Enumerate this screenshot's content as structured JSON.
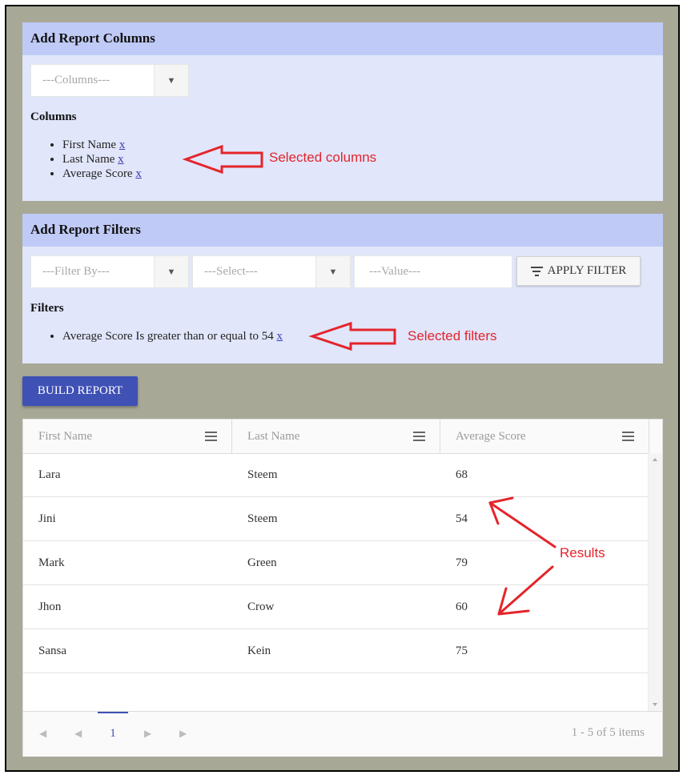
{
  "columns_panel": {
    "title": "Add Report Columns",
    "columns_select_placeholder": "---Columns---",
    "list_title": "Columns",
    "items": [
      {
        "label": "First Name",
        "remove": "x"
      },
      {
        "label": "Last Name",
        "remove": "x"
      },
      {
        "label": "Average Score",
        "remove": "x"
      }
    ]
  },
  "filters_panel": {
    "title": "Add Report Filters",
    "filter_by_placeholder": "---Filter By---",
    "operator_placeholder": "---Select---",
    "value_placeholder": "---Value---",
    "apply_label": "APPLY FILTER",
    "list_title": "Filters",
    "items": [
      {
        "label": "Average Score Is greater than or equal to 54",
        "remove": "x"
      }
    ]
  },
  "build_label": "BUILD REPORT",
  "grid": {
    "headers": [
      "First Name",
      "Last Name",
      "Average Score"
    ],
    "rows": [
      [
        "Lara",
        "Steem",
        "68"
      ],
      [
        "Jini",
        "Steem",
        "54"
      ],
      [
        "Mark",
        "Green",
        "79"
      ],
      [
        "Jhon",
        "Crow",
        "60"
      ],
      [
        "Sansa",
        "Kein",
        "75"
      ]
    ],
    "pager": {
      "current_page": "1",
      "info": "1 - 5 of 5 items",
      "first_icon": "first-page-icon",
      "prev_icon": "prev-page-icon",
      "next_icon": "next-page-icon",
      "last_icon": "last-page-icon"
    }
  },
  "annotations": {
    "columns": "Selected columns",
    "filters": "Selected filters",
    "results": "Results",
    "color": "#e3252b"
  }
}
